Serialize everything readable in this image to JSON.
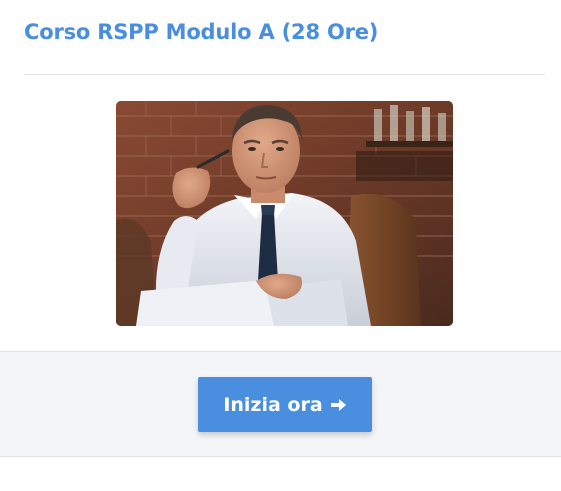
{
  "course": {
    "title": "Corso RSPP Modulo A (28 Ore)"
  },
  "image": {
    "subject": "man in white shirt and tie reading documents"
  },
  "footer": {
    "start_label": "Inizia ora",
    "start_icon": "arrow-right-icon"
  },
  "colors": {
    "accent": "#4a8ee0",
    "footer_bg": "#f4f5f7",
    "divider": "#e4e6ea"
  }
}
